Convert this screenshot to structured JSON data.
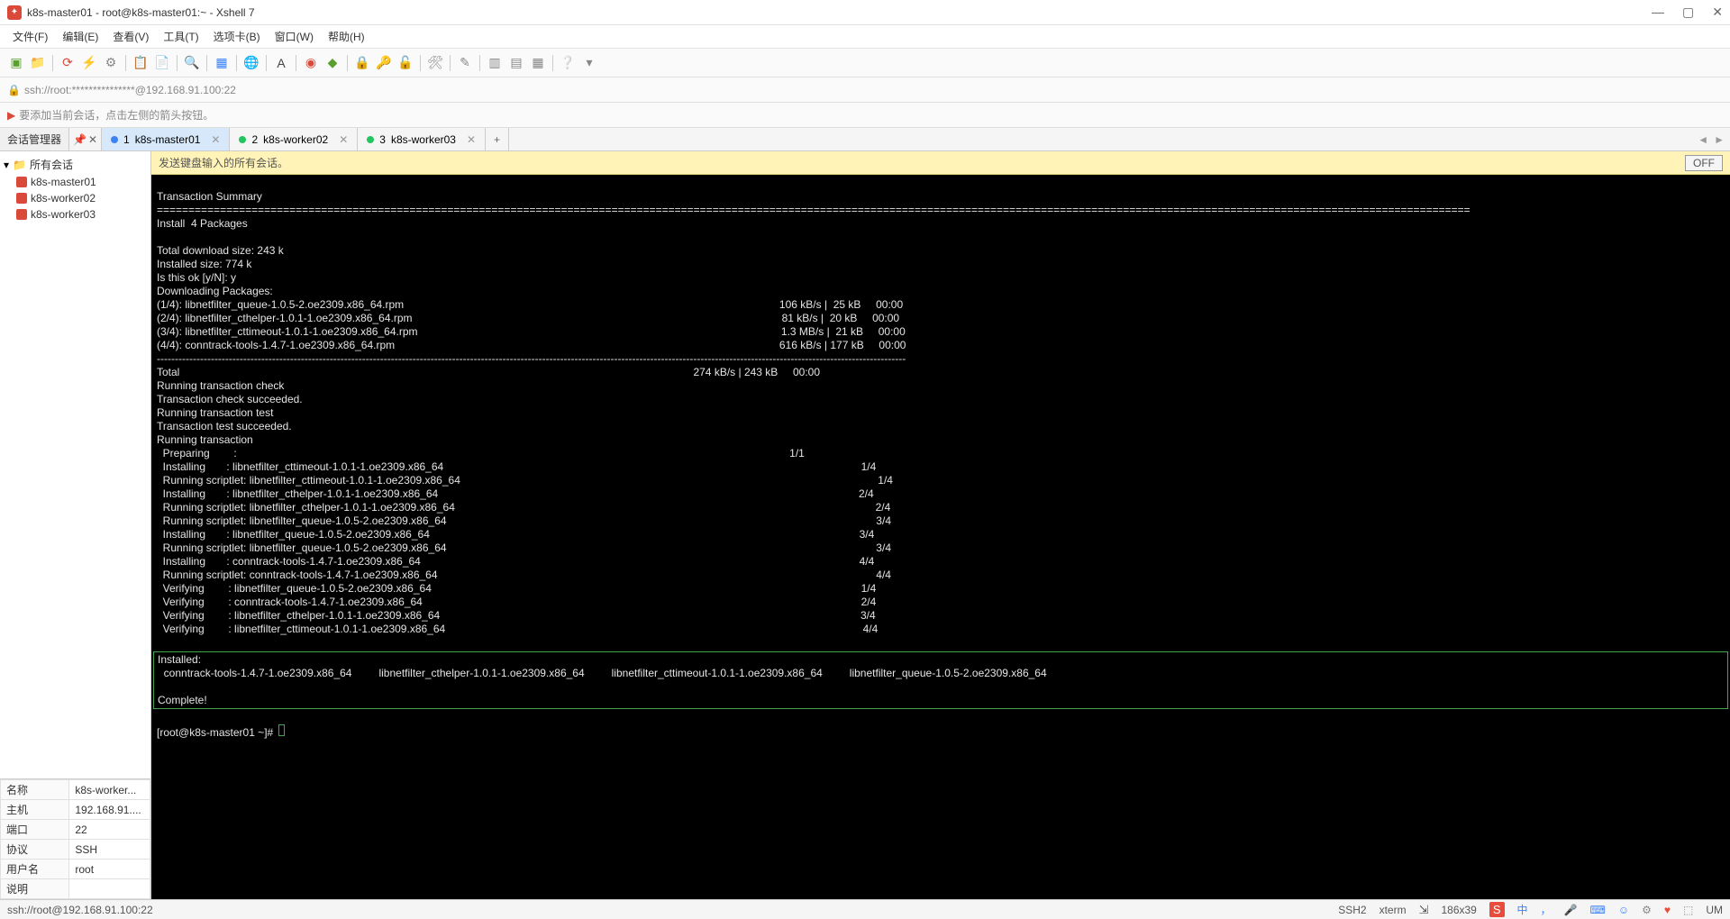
{
  "window": {
    "title": "k8s-master01 - root@k8s-master01:~ - Xshell 7"
  },
  "menu": {
    "file": "文件(F)",
    "edit": "编辑(E)",
    "view": "查看(V)",
    "tools": "工具(T)",
    "tabs": "选项卡(B)",
    "window": "窗口(W)",
    "help": "帮助(H)"
  },
  "address": "ssh://root:***************@192.168.91.100:22",
  "hint": "要添加当前会话，点击左侧的箭头按钮。",
  "session_manager_label": "会话管理器",
  "tabs": [
    {
      "num": "1",
      "name": "k8s-master01",
      "active": true,
      "color": "blue"
    },
    {
      "num": "2",
      "name": "k8s-worker02",
      "active": false,
      "color": "green"
    },
    {
      "num": "3",
      "name": "k8s-worker03",
      "active": false,
      "color": "green"
    }
  ],
  "tree": {
    "root": "所有会话",
    "items": [
      "k8s-master01",
      "k8s-worker02",
      "k8s-worker03"
    ]
  },
  "props": {
    "name_label": "名称",
    "name_value": "k8s-worker...",
    "host_label": "主机",
    "host_value": "192.168.91....",
    "port_label": "端口",
    "port_value": "22",
    "proto_label": "协议",
    "proto_value": "SSH",
    "user_label": "用户名",
    "user_value": "root",
    "desc_label": "说明",
    "desc_value": ""
  },
  "sendbar": {
    "text": "发送键盘输入的所有会话。",
    "off": "OFF"
  },
  "terminal": {
    "lines": [
      "Transaction Summary",
      "================================================================================================================================================================================================================",
      "Install  4 Packages",
      "",
      "Total download size: 243 k",
      "Installed size: 774 k",
      "Is this ok [y/N]: y",
      "Downloading Packages:",
      "(1/4): libnetfilter_queue-1.0.5-2.oe2309.x86_64.rpm                                                                                                                             106 kB/s |  25 kB     00:00",
      "(2/4): libnetfilter_cthelper-1.0.1-1.oe2309.x86_64.rpm                                                                                                                           81 kB/s |  20 kB     00:00",
      "(3/4): libnetfilter_cttimeout-1.0.1-1.oe2309.x86_64.rpm                                                                                                                         1.3 MB/s |  21 kB     00:00",
      "(4/4): conntrack-tools-1.4.7-1.oe2309.x86_64.rpm                                                                                                                                616 kB/s | 177 kB     00:00",
      "----------------------------------------------------------------------------------------------------------------------------------------------------------------------------------------------------------------",
      "Total                                                                                                                                                                           274 kB/s | 243 kB     00:00",
      "Running transaction check",
      "Transaction check succeeded.",
      "Running transaction test",
      "Transaction test succeeded.",
      "Running transaction",
      "  Preparing        :                                                                                                                                                                                        1/1",
      "  Installing       : libnetfilter_cttimeout-1.0.1-1.oe2309.x86_64                                                                                                                                           1/4",
      "  Running scriptlet: libnetfilter_cttimeout-1.0.1-1.oe2309.x86_64                                                                                                                                           1/4",
      "  Installing       : libnetfilter_cthelper-1.0.1-1.oe2309.x86_64                                                                                                                                            2/4",
      "  Running scriptlet: libnetfilter_cthelper-1.0.1-1.oe2309.x86_64                                                                                                                                            2/4",
      "  Running scriptlet: libnetfilter_queue-1.0.5-2.oe2309.x86_64                                                                                                                                               3/4",
      "  Installing       : libnetfilter_queue-1.0.5-2.oe2309.x86_64                                                                                                                                               3/4",
      "  Running scriptlet: libnetfilter_queue-1.0.5-2.oe2309.x86_64                                                                                                                                               3/4",
      "  Installing       : conntrack-tools-1.4.7-1.oe2309.x86_64                                                                                                                                                  4/4",
      "  Running scriptlet: conntrack-tools-1.4.7-1.oe2309.x86_64                                                                                                                                                  4/4",
      "  Verifying        : libnetfilter_queue-1.0.5-2.oe2309.x86_64                                                                                                                                               1/4",
      "  Verifying        : conntrack-tools-1.4.7-1.oe2309.x86_64                                                                                                                                                  2/4",
      "  Verifying        : libnetfilter_cthelper-1.0.1-1.oe2309.x86_64                                                                                                                                            3/4",
      "  Verifying        : libnetfilter_cttimeout-1.0.1-1.oe2309.x86_64                                                                                                                                           4/4"
    ],
    "installed_block": "Installed:\n  conntrack-tools-1.4.7-1.oe2309.x86_64         libnetfilter_cthelper-1.0.1-1.oe2309.x86_64         libnetfilter_cttimeout-1.0.1-1.oe2309.x86_64         libnetfilter_queue-1.0.5-2.oe2309.x86_64\n\nComplete!",
    "prompt": "[root@k8s-master01 ~]# "
  },
  "status": {
    "addr": "ssh://root@192.168.91.100:22",
    "proto": "SSH2",
    "termtype": "xterm",
    "size": "186x39",
    "ime": "中",
    "num": "UM"
  }
}
